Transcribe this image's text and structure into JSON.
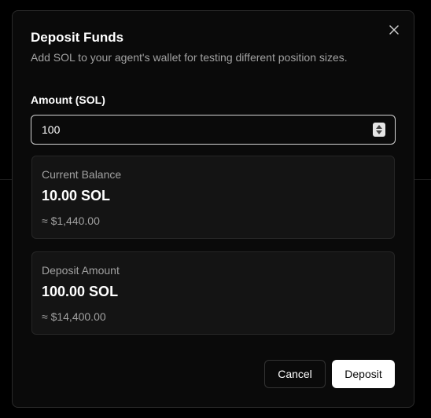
{
  "dialog": {
    "title": "Deposit Funds",
    "subtitle": "Add SOL to your agent's wallet for testing different position sizes.",
    "close_icon": "close-icon"
  },
  "amount_field": {
    "label": "Amount (SOL)",
    "value": "100"
  },
  "current_balance": {
    "label": "Current Balance",
    "value": "10.00 SOL",
    "usd": "≈ $1,440.00"
  },
  "deposit_amount": {
    "label": "Deposit Amount",
    "value": "100.00 SOL",
    "usd": "≈ $14,400.00"
  },
  "actions": {
    "cancel_label": "Cancel",
    "deposit_label": "Deposit"
  },
  "colors": {
    "background": "#0a0a0a",
    "card": "#141414",
    "muted_text": "#a1a1a1",
    "primary_button": "#ffffff"
  }
}
